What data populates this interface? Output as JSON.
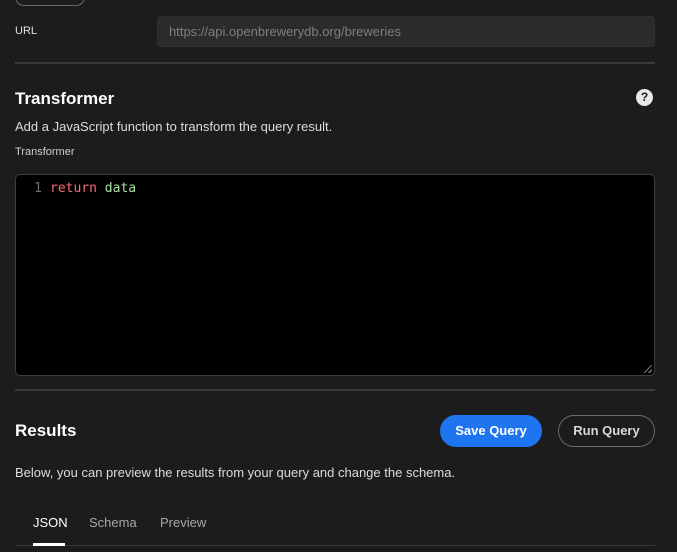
{
  "url_field": {
    "label": "URL",
    "placeholder": "https://api.openbrewerydb.org/breweries"
  },
  "transformer": {
    "title": "Transformer",
    "help_glyph": "?",
    "description": "Add a JavaScript function to transform the query result.",
    "field_label": "Transformer",
    "code": {
      "line_number": "1",
      "keyword": "return",
      "identifier": "data"
    }
  },
  "results": {
    "title": "Results",
    "save_label": "Save Query",
    "run_label": "Run Query",
    "description": "Below, you can preview the results from your query and change the schema.",
    "tabs": [
      {
        "label": "JSON",
        "active": true
      },
      {
        "label": "Schema",
        "active": false
      },
      {
        "label": "Preview",
        "active": false
      }
    ]
  },
  "colors": {
    "background": "#1c1c1c",
    "primary_button": "#1f74f0",
    "keyword": "#ff6b7a",
    "identifier": "#a6e3a1"
  },
  "icons": {
    "help": "help-icon"
  }
}
